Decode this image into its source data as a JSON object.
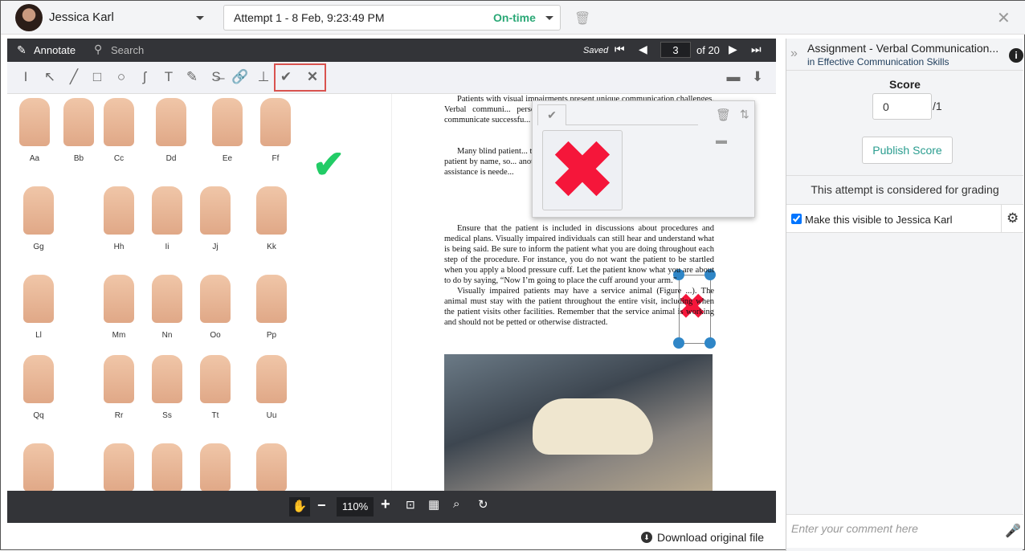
{
  "header": {
    "user_name": "Jessica Karl",
    "attempt_label": "Attempt 1 - 8 Feb, 9:23:49 PM",
    "attempt_status": "On-time",
    "status_color": "#2aa876"
  },
  "viewer_toolbar": {
    "annotate_label": "Annotate",
    "search_label": "Search",
    "saved_label": "Saved",
    "current_page": "3",
    "page_total_label": "of 20"
  },
  "annotation_tools": [
    "text-cursor-icon",
    "arrow-icon",
    "line-icon",
    "rectangle-icon",
    "circle-icon",
    "freehand-icon",
    "text-icon",
    "highlighter-icon",
    "strikethrough-icon",
    "link-icon",
    "stamp-icon",
    "checkmark-icon",
    "cross-icon"
  ],
  "sign_chart": {
    "rows": [
      [
        "Aa",
        "Bb",
        "Cc",
        "Dd",
        "Ee",
        "Ff"
      ],
      [
        "Gg",
        "Hh",
        "Ii",
        "Jj",
        "Kk"
      ],
      [
        "Ll",
        "Mm",
        "Nn",
        "Oo",
        "Pp"
      ],
      [
        "Qq",
        "Rr",
        "Ss",
        "Tt",
        "Uu"
      ]
    ]
  },
  "document": {
    "paragraphs": [
      "Patients with visual impairments present unique communication challenges. Verbal communi... person communicates w... ally impaired person, y... communicate successfu...",
      "Many blind patient... them adjust to the envir... temporarily, perhaps in... the patient by name, so... another person in the ro... chair by placing his or l... what assistance is neede...",
      "Ensure that the patient is included in discussions about procedures and medical plans. Visually impaired individuals can still hear and understand what is being said. Be sure to inform the patient what you are doing throughout each step of the procedure. For instance, you do not want the patient to be startled when you apply a blood pressure cuff. Let the patient know what you are about to do by saying, “Now I’m going to place the cuff around your arm.”",
      "Visually impaired patients may have a service animal (Figure ...). The animal must stay with the patient throughout the entire visit, including when the patient visits other facilities. Remember that the service animal is working and should not be petted or otherwise distracted."
    ]
  },
  "bottom_toolbar": {
    "zoom_level": "110%"
  },
  "download_label": "Download original file",
  "panel": {
    "assignment_title": "Assignment - Verbal Communication...",
    "course": "in Effective Communication Skills",
    "score_label": "Score",
    "score_value": "0",
    "score_max": "/1",
    "publish_label": "Publish Score",
    "grading_note": "This attempt is considered for grading",
    "visible_label": "Make this visible to Jessica Karl",
    "visible_checked": true,
    "comment_placeholder": "Enter your comment here"
  }
}
